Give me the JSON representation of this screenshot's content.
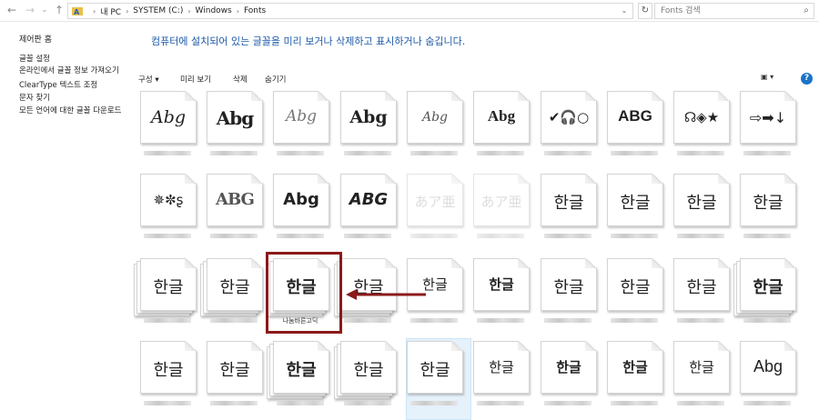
{
  "address": {
    "crumbs": [
      "내 PC",
      "SYSTEM (C:)",
      "Windows",
      "Fonts"
    ],
    "search_placeholder": "Fonts 검색"
  },
  "left_pane": {
    "home": "제어판 홈",
    "links": [
      "글꼴 설정",
      "온라인에서 글꼴 정보 가져오기",
      "ClearType 텍스트 조정",
      "문자 찾기",
      "모든 언어에 대한 글꼴 다운로드"
    ]
  },
  "description": "컴퓨터에 설치되어 있는 글꼴을 미리 보거나 삭제하고 표시하거나 숨깁니다.",
  "toolbar": {
    "organize": "구성 ▾",
    "preview": "미리 보기",
    "delete": "삭제",
    "hide": "숨기기",
    "help": "?"
  },
  "fonts": [
    {
      "sample": "Abg",
      "style": "script1"
    },
    {
      "sample": "Abg",
      "style": "blackletter"
    },
    {
      "sample": "Abg",
      "style": "script2"
    },
    {
      "sample": "Abg",
      "style": "serifbold"
    },
    {
      "sample": "Abg",
      "style": "script3"
    },
    {
      "sample": "Abg",
      "style": "bold"
    },
    {
      "sample": "✔🎧○",
      "style": "sym1"
    },
    {
      "sample": "ABG",
      "style": "caps"
    },
    {
      "sample": "☊◈★",
      "style": "sym2"
    },
    {
      "sample": "⇨➡↓",
      "style": "sym3"
    },
    {
      "sample": "✵✼ʂ",
      "style": "sym4"
    },
    {
      "sample": "ABG",
      "style": "engraved"
    },
    {
      "sample": "Abg",
      "style": "rounded"
    },
    {
      "sample": "ABG",
      "style": "comic"
    },
    {
      "sample": "あア亜",
      "style": "faded"
    },
    {
      "sample": "あア亜",
      "style": "faded"
    },
    {
      "sample": "한글",
      "style": "kr"
    },
    {
      "sample": "한글",
      "style": "kr"
    },
    {
      "sample": "한글",
      "style": "kr"
    },
    {
      "sample": "한글",
      "style": "kr"
    },
    {
      "sample": "한글",
      "style": "kr"
    },
    {
      "sample": "한글",
      "style": "kr"
    },
    {
      "sample": "한글",
      "style": "krbold",
      "name": "나눔바른고딕"
    },
    {
      "sample": "한글",
      "style": "kr"
    },
    {
      "sample": "한글",
      "style": "krhand"
    },
    {
      "sample": "한글",
      "style": "krhand2"
    },
    {
      "sample": "한글",
      "style": "kr"
    },
    {
      "sample": "한글",
      "style": "kr"
    },
    {
      "sample": "한글",
      "style": "kr"
    },
    {
      "sample": "한글",
      "style": "krbold"
    },
    {
      "sample": "한글",
      "style": "kr"
    },
    {
      "sample": "한글",
      "style": "kr"
    },
    {
      "sample": "한글",
      "style": "krbold"
    },
    {
      "sample": "한글",
      "style": "kr"
    },
    {
      "sample": "한글",
      "style": "kr"
    },
    {
      "sample": "한글",
      "style": "krhand"
    },
    {
      "sample": "한글",
      "style": "krhandbold"
    },
    {
      "sample": "한글",
      "style": "krhandbold"
    },
    {
      "sample": "한글",
      "style": "krhand"
    },
    {
      "sample": "Abg",
      "style": "plain"
    }
  ]
}
